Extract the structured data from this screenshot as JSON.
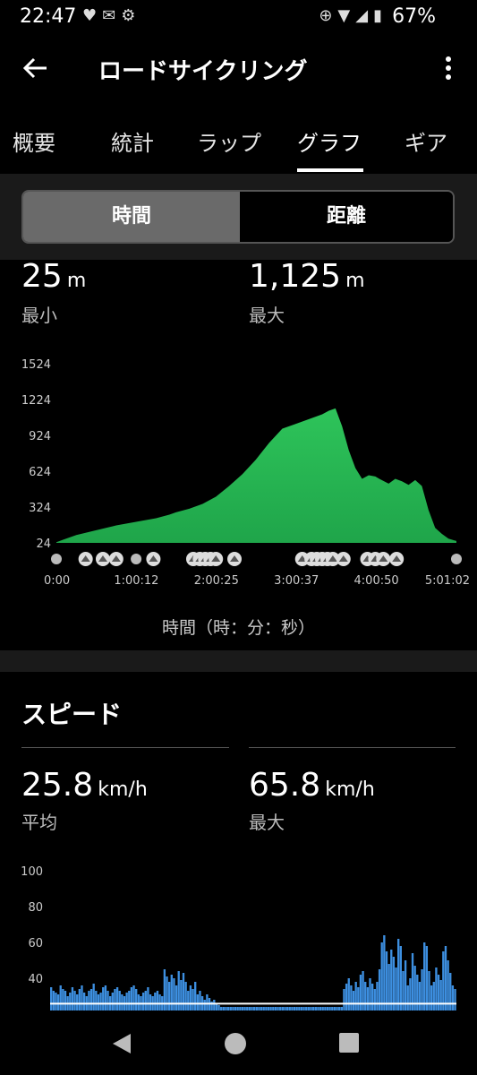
{
  "status_bar": {
    "time": "22:47",
    "battery": "67%",
    "left_icons": [
      "heart-icon",
      "notification-icon",
      "app-icon"
    ],
    "right_icons": [
      "add-circle-icon",
      "wifi-icon",
      "signal-icon",
      "battery-icon"
    ]
  },
  "appbar": {
    "title": "ロードサイクリング"
  },
  "tabs": [
    {
      "label": "概要"
    },
    {
      "label": "統計"
    },
    {
      "label": "ラップ"
    },
    {
      "label": "グラフ",
      "selected": true
    },
    {
      "label": "ギア"
    }
  ],
  "segment": {
    "left": "時間",
    "right": "距離",
    "selected": "left"
  },
  "elevation": {
    "min_value": "25",
    "min_unit": "m",
    "min_label": "最小",
    "max_value": "1,125",
    "max_unit": "m",
    "max_label": "最大",
    "x_axis_label": "時間（時：分：秒）"
  },
  "speed": {
    "title": "スピード",
    "avg_value": "25.8",
    "avg_unit": "km/h",
    "avg_label": "平均",
    "max_value": "65.8",
    "max_unit": "km/h",
    "max_label": "最大"
  },
  "colors": {
    "elevation_fill": "#1fa54a",
    "speed_bar": "#3d8fe0",
    "background": "#000000"
  },
  "chart_data": [
    {
      "type": "area",
      "title": "",
      "y_ticks": [
        24,
        324,
        624,
        924,
        1224,
        1524
      ],
      "ylim": [
        24,
        1524
      ],
      "x_tick_labels": [
        "0:00",
        "1:00:12",
        "2:00:25",
        "3:00:37",
        "4:00:50",
        "5:01:02"
      ],
      "x_unit": "minutes",
      "x": [
        0,
        5,
        15,
        30,
        45,
        60,
        75,
        85,
        90,
        100,
        110,
        120,
        130,
        140,
        150,
        160,
        170,
        180,
        190,
        200,
        205,
        210,
        215,
        220,
        225,
        230,
        235,
        240,
        243,
        250,
        255,
        260,
        265,
        270,
        275,
        280,
        285,
        290,
        295,
        301
      ],
      "y": [
        30,
        50,
        90,
        130,
        170,
        200,
        230,
        260,
        280,
        310,
        350,
        410,
        500,
        600,
        720,
        860,
        980,
        1020,
        1060,
        1100,
        1130,
        1150,
        1000,
        800,
        650,
        560,
        590,
        580,
        560,
        520,
        560,
        540,
        510,
        550,
        500,
        300,
        150,
        100,
        60,
        40
      ],
      "markers_minutes": [
        0,
        22,
        35,
        45,
        60,
        73,
        103,
        108,
        112,
        116,
        120,
        134,
        185,
        192,
        196,
        200,
        204,
        208,
        216,
        234,
        240,
        246,
        256,
        301
      ]
    },
    {
      "type": "bar",
      "title": "",
      "y_ticks": [
        40,
        60,
        80,
        100
      ],
      "ylim": [
        20,
        100
      ],
      "series": [
        {
          "values_description_free": true,
          "values": [
            35,
            33,
            32,
            31,
            36,
            34,
            33,
            30,
            32,
            35,
            33,
            31,
            34,
            36,
            32,
            30,
            33,
            34,
            37,
            33,
            31,
            32,
            35,
            36,
            33,
            30,
            32,
            34,
            35,
            33,
            31,
            30,
            32,
            33,
            35,
            36,
            34,
            31,
            30,
            32,
            33,
            35,
            31,
            30,
            32,
            33,
            31,
            30,
            45,
            41,
            38,
            42,
            40,
            36,
            44,
            39,
            43,
            38,
            33,
            36,
            34,
            38,
            31,
            33,
            30,
            28,
            31,
            29,
            27,
            28,
            26,
            25,
            24,
            24,
            24,
            24,
            24,
            24,
            24,
            24,
            24,
            24,
            24,
            24,
            24,
            24,
            24,
            24,
            24,
            24,
            24,
            24,
            24,
            24,
            24,
            24,
            24,
            24,
            24,
            24,
            24,
            24,
            24,
            24,
            24,
            24,
            24,
            24,
            24,
            24,
            24,
            24,
            24,
            24,
            24,
            24,
            24,
            24,
            24,
            24,
            24,
            24,
            24,
            24,
            34,
            37,
            40,
            36,
            33,
            38,
            35,
            42,
            44,
            38,
            35,
            40,
            37,
            34,
            38,
            45,
            60,
            64,
            55,
            48,
            56,
            52,
            46,
            62,
            58,
            44,
            50,
            36,
            40,
            54,
            47,
            42,
            38,
            45,
            60,
            58,
            44,
            36,
            38,
            46,
            42,
            39,
            55,
            58,
            50,
            43,
            36,
            34
          ]
        }
      ]
    }
  ]
}
